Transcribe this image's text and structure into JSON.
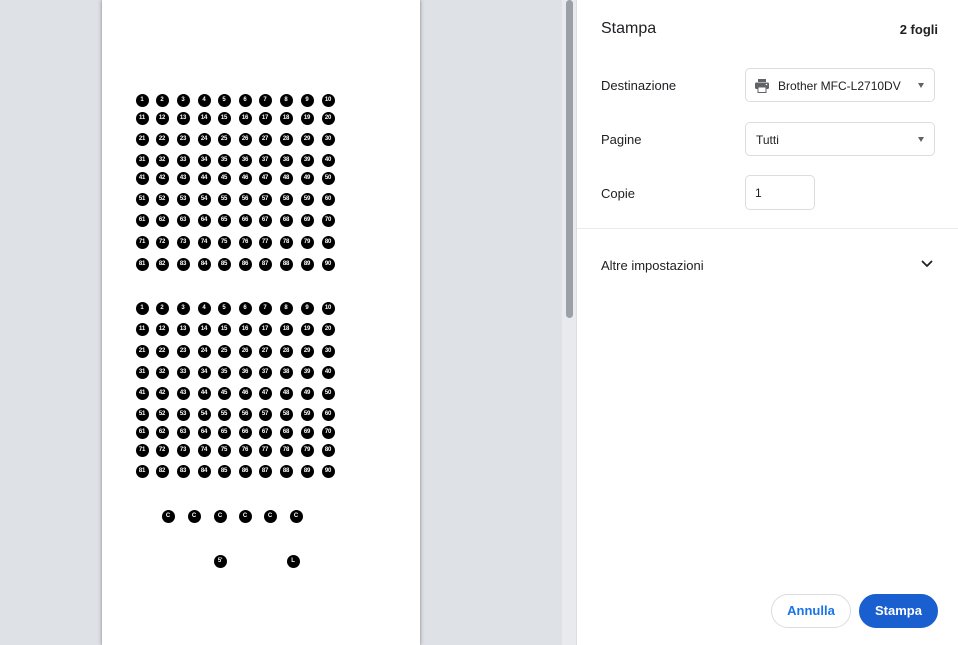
{
  "preview": {
    "grid_labels": [
      [
        "1",
        "2",
        "3",
        "4",
        "5",
        "6",
        "7",
        "8",
        "9",
        "10"
      ],
      [
        "11",
        "12",
        "13",
        "14",
        "15",
        "16",
        "17",
        "18",
        "19",
        "20"
      ],
      [
        "21",
        "22",
        "23",
        "24",
        "25",
        "26",
        "27",
        "28",
        "29",
        "30"
      ],
      [
        "31",
        "32",
        "33",
        "34",
        "35",
        "36",
        "37",
        "38",
        "39",
        "40"
      ],
      [
        "41",
        "42",
        "43",
        "44",
        "45",
        "46",
        "47",
        "48",
        "49",
        "50"
      ],
      [
        "51",
        "52",
        "53",
        "54",
        "55",
        "56",
        "57",
        "58",
        "59",
        "60"
      ],
      [
        "61",
        "62",
        "63",
        "64",
        "65",
        "66",
        "67",
        "68",
        "69",
        "70"
      ],
      [
        "71",
        "72",
        "73",
        "74",
        "75",
        "76",
        "77",
        "78",
        "79",
        "80"
      ],
      [
        "81",
        "82",
        "83",
        "84",
        "85",
        "86",
        "87",
        "88",
        "89",
        "90"
      ]
    ],
    "c_row": [
      "C",
      "C",
      "C",
      "C",
      "C",
      "C"
    ],
    "extra": [
      "5'",
      "L"
    ]
  },
  "panel": {
    "title": "Stampa",
    "sheet_count": "2 fogli",
    "destination_label": "Destinazione",
    "destination_value": "Brother MFC-L2710DV",
    "pages_label": "Pagine",
    "pages_value": "Tutti",
    "copies_label": "Copie",
    "copies_value": "1",
    "more_settings_label": "Altre impostazioni",
    "cancel_label": "Annulla",
    "print_label": "Stampa"
  },
  "colors": {
    "accent": "#1a73e8",
    "primary_button": "#1a5fd0",
    "preview_background": "#dee1e6"
  },
  "icons": {
    "printer": "printer-icon",
    "dropdown": "triangle-down-icon",
    "expand": "chevron-down-icon"
  }
}
